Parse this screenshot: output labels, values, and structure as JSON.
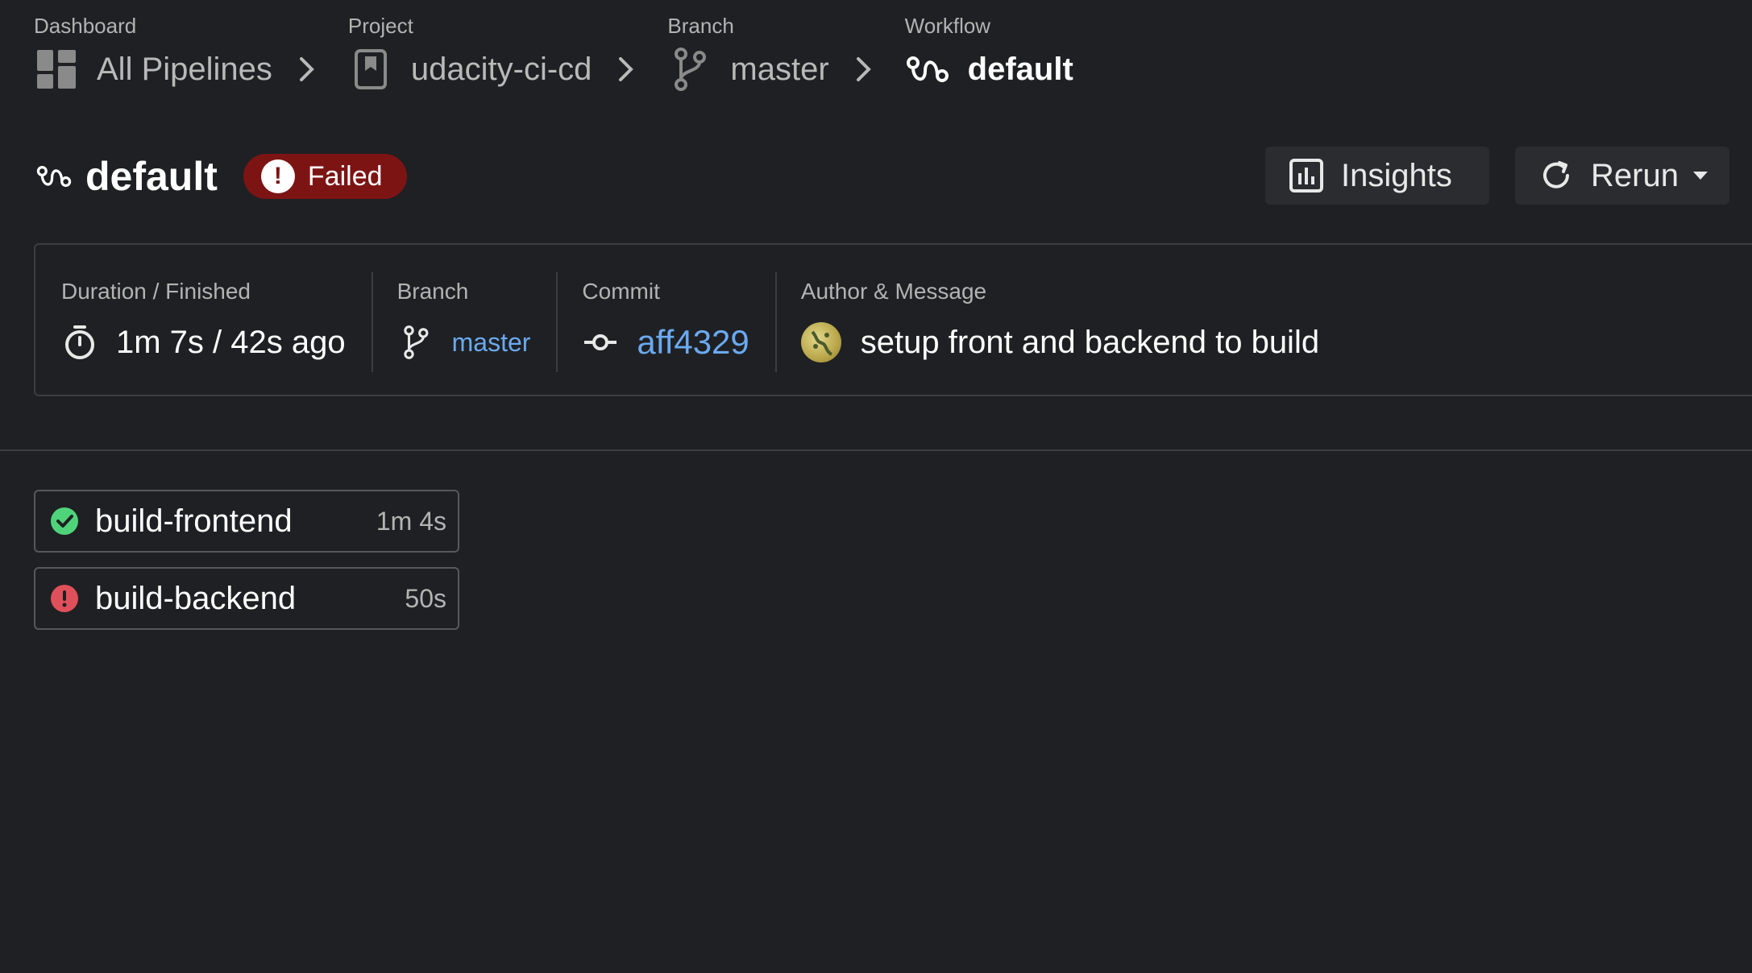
{
  "breadcrumb": {
    "dashboard": {
      "caption": "Dashboard",
      "label": "All Pipelines",
      "icon": "dashboard-grid-icon"
    },
    "project": {
      "caption": "Project",
      "label": "udacity-ci-cd",
      "icon": "project-bookmark-icon"
    },
    "branch": {
      "caption": "Branch",
      "label": "master",
      "icon": "git-branch-icon"
    },
    "workflow": {
      "caption": "Workflow",
      "label": "default",
      "icon": "workflow-icon"
    }
  },
  "header": {
    "title": "default",
    "status": "Failed",
    "insights_label": "Insights",
    "rerun_label": "Rerun"
  },
  "info": {
    "duration_label": "Duration / Finished",
    "duration_value": "1m 7s / 42s ago",
    "branch_label": "Branch",
    "branch_value": "master",
    "commit_label": "Commit",
    "commit_value": "aff4329",
    "author_label": "Author & Message",
    "message": "setup front and backend to build"
  },
  "jobs": [
    {
      "name": "build-frontend",
      "duration": "1m 4s",
      "status": "success"
    },
    {
      "name": "build-backend",
      "duration": "50s",
      "status": "failed"
    }
  ],
  "colors": {
    "background": "#1f2023",
    "failed_badge": "#7d1414",
    "link": "#6aaaf0",
    "success": "#4fd37a",
    "failed": "#e0505a"
  }
}
